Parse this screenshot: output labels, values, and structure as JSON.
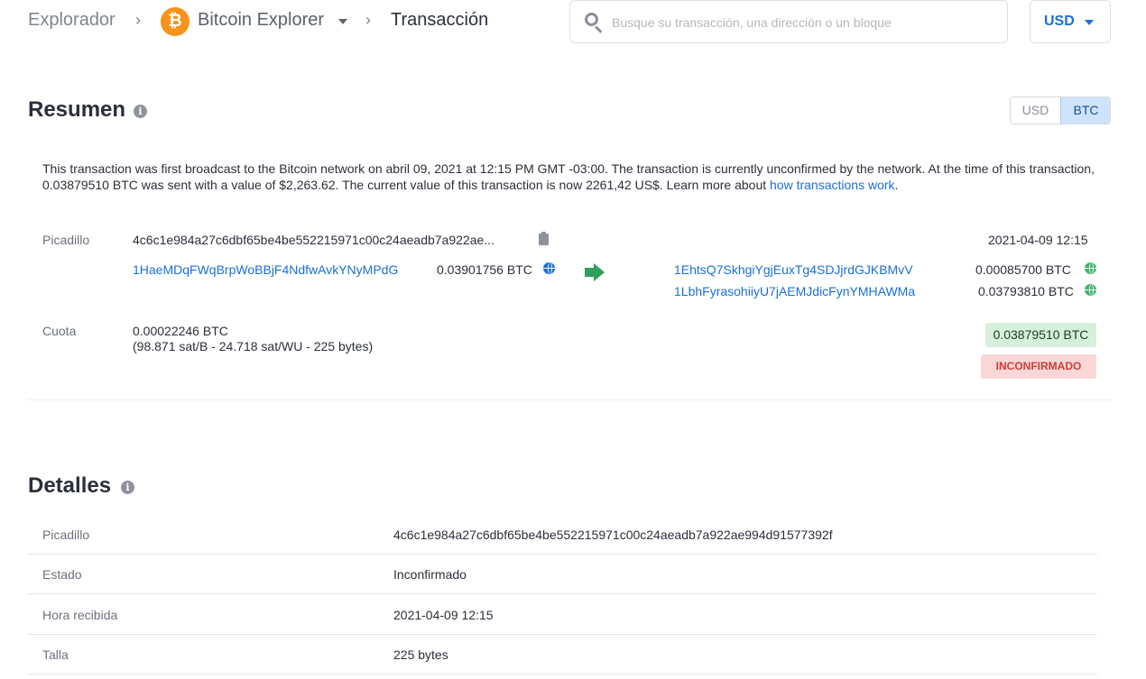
{
  "breadcrumb": {
    "root": "Explorador",
    "network": "Bitcoin Explorer",
    "current": "Transacción",
    "logo_symbol": "₿"
  },
  "search": {
    "placeholder": "Busque su transacción, una dirección o un bloque"
  },
  "currency_selector": {
    "value": "USD"
  },
  "summary": {
    "title": "Resumen",
    "toggle": {
      "usd": "USD",
      "btc": "BTC",
      "active": "BTC"
    },
    "text_main": "This transaction was first broadcast to the Bitcoin network on abril 09, 2021 at 12:15 PM GMT -03:00.  The transaction is currently unconfirmed by the network.  At the time of this transaction, 0.03879510 BTC was sent with a value of $2,263.62. The current value of this transaction is now 2261,42 US$.  Learn more about ",
    "text_link": "how transactions work",
    "text_end": ".",
    "hash_label": "Picadillo",
    "hash_value": "4c6c1e984a27c6dbf65be4be552215971c00c24aeadb7a922ae...",
    "timestamp": "2021-04-09 12:15",
    "inputs": [
      {
        "address": "1HaeMDqFWqBrpWoBBjF4NdfwAvkYNyMPdG",
        "amount": "0.03901756 BTC"
      }
    ],
    "outputs": [
      {
        "address": "1EhtsQ7SkhgiYgjEuxTg4SDJjrdGJKBMvV",
        "amount": "0.00085700 BTC"
      },
      {
        "address": "1LbhFyrasohiiyU7jAEMJdicFynYMHAWMa",
        "amount": "0.03793810 BTC"
      }
    ],
    "fee_label": "Cuota",
    "fee_value": "0.00022246 BTC",
    "fee_detail": "(98.871 sat/B - 24.718 sat/WU - 225 bytes)",
    "total": "0.03879510 BTC",
    "status": "INCONFIRMADO"
  },
  "details": {
    "title": "Detalles",
    "rows": [
      {
        "key": "Picadillo",
        "value": "4c6c1e984a27c6dbf65be4be552215971c00c24aeadb7a922ae994d91577392f"
      },
      {
        "key": "Estado",
        "value": "Inconfirmado"
      },
      {
        "key": "Hora recibida",
        "value": "2021-04-09 12:15"
      },
      {
        "key": "Talla",
        "value": "225 bytes"
      }
    ]
  },
  "colors": {
    "link": "#1a6fd6",
    "bitcoin": "#f7931a",
    "arrow": "#2ea05a",
    "total_bg": "#d6f0dc",
    "status_bg": "#f8d7d6",
    "status_text": "#d23b35"
  }
}
